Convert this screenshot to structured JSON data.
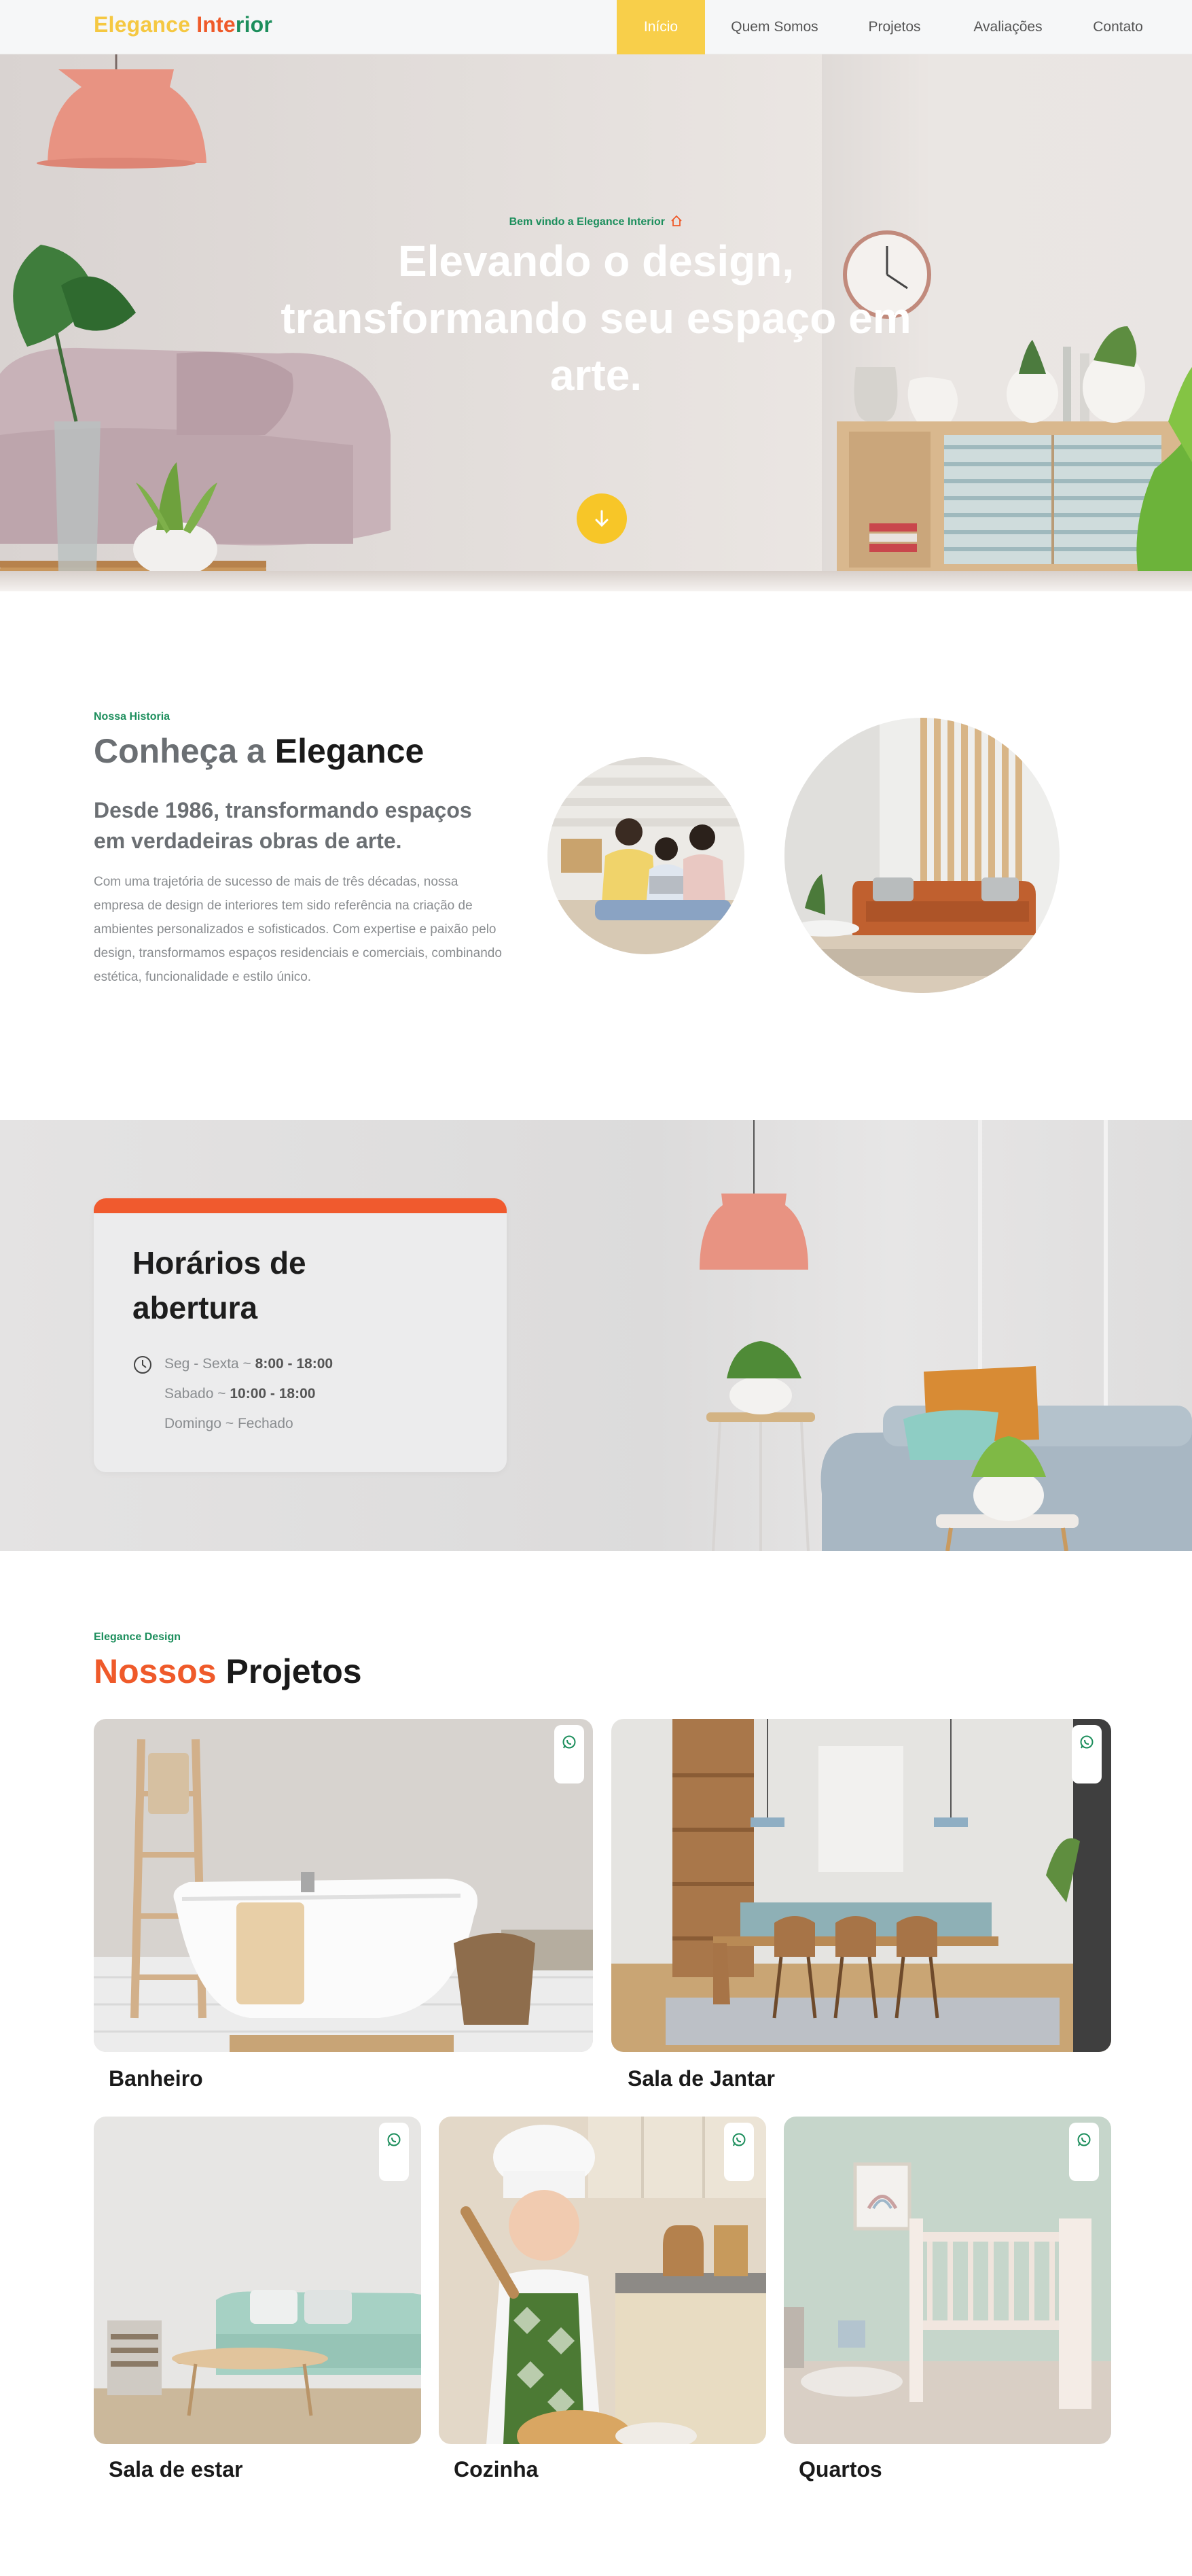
{
  "nav": {
    "logo_word1": "Elegance",
    "logo_word2_part1": "Inte",
    "logo_word2_part2": "rior",
    "items": [
      "Início",
      "Quem Somos",
      "Projetos",
      "Avaliações",
      "Contato"
    ],
    "active": "Início"
  },
  "hero": {
    "tagline": "Bem vindo a Elegance Interior",
    "title": "Elevando o design, transformando seu espaço em arte.",
    "scroll_icon": "arrow-down-icon"
  },
  "about": {
    "tag": "Nossa Historia",
    "title_part1": "Conheça a",
    "title_part2": "Elegance",
    "subtitle": "Desde 1986, transformando espaços em verdadeiras obras de arte.",
    "body": "Com uma trajetória de sucesso de mais de três décadas, nossa empresa de design de interiores tem sido referência na criação de ambientes personalizados e sofisticados. Com expertise e paixão pelo design, transformamos espaços residenciais e comerciais, combinando estética, funcionalidade e estilo único."
  },
  "hours": {
    "title": "Horários de abertura",
    "rows": [
      {
        "day": "Seg - Sexta ~",
        "time": "8:00 - 18:00"
      },
      {
        "day": "Sabado ~",
        "time": "10:00 - 18:00"
      },
      {
        "day": "Domingo ~ Fechado",
        "time": ""
      }
    ]
  },
  "projects": {
    "tag": "Elegance Design",
    "title_part1": "Nossos",
    "title_part2": "Projetos",
    "items": [
      {
        "label": "Banheiro"
      },
      {
        "label": "Sala de Jantar"
      },
      {
        "label": "Sala de estar"
      },
      {
        "label": "Cozinha"
      },
      {
        "label": "Quartos"
      }
    ]
  },
  "colors": {
    "brand_yellow": "#f8cf4a",
    "brand_orange": "#ef5a2a",
    "brand_green": "#1c8e5c"
  }
}
